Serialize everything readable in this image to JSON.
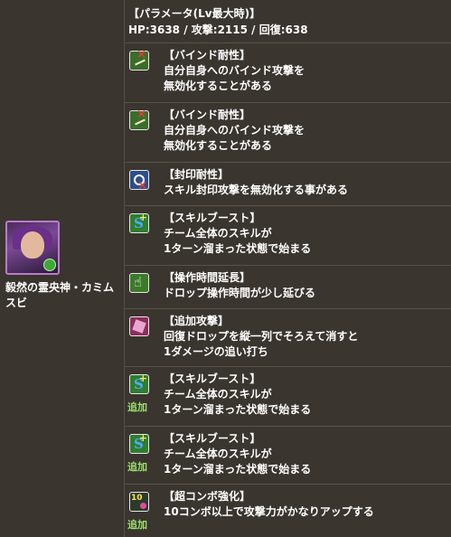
{
  "monster": {
    "name": "毅然の霊央神・カミムスビ"
  },
  "parameters": {
    "title": "【パラメータ(Lv最大時)】",
    "values": "HP:3638 / 攻撃:2115 / 回復:638"
  },
  "awakenings": [
    {
      "icon": "bind-resist-icon",
      "title": "【バインド耐性】",
      "lines": [
        "自分自身へのバインド攻撃を",
        "無効化することがある"
      ],
      "added": ""
    },
    {
      "icon": "bind-resist-icon",
      "title": "【バインド耐性】",
      "lines": [
        "自分自身へのバインド攻撃を",
        "無効化することがある"
      ],
      "added": ""
    },
    {
      "icon": "seal-resist-icon",
      "title": "【封印耐性】",
      "lines": [
        "スキル封印攻撃を無効化する事がある",
        ""
      ],
      "added": ""
    },
    {
      "icon": "skill-boost-icon",
      "title": "【スキルブースト】",
      "lines": [
        "チーム全体のスキルが",
        "1ターン溜まった状態で始まる"
      ],
      "added": ""
    },
    {
      "icon": "time-extend-icon",
      "title": "【操作時間延長】",
      "lines": [
        "ドロップ操作時間が少し延びる",
        ""
      ],
      "added": ""
    },
    {
      "icon": "pursuit-icon",
      "title": "【追加攻撃】",
      "lines": [
        "回復ドロップを縦一列でそろえて消すと",
        "1ダメージの追い打ち"
      ],
      "added": ""
    },
    {
      "icon": "skill-boost-icon",
      "title": "【スキルブースト】",
      "lines": [
        "チーム全体のスキルが",
        "1ターン溜まった状態で始まる"
      ],
      "added": "追加"
    },
    {
      "icon": "skill-boost-icon",
      "title": "【スキルブースト】",
      "lines": [
        "チーム全体のスキルが",
        "1ターン溜まった状態で始まる"
      ],
      "added": "追加"
    },
    {
      "icon": "combo-boost-icon",
      "title": "【超コンボ強化】",
      "lines": [
        "10コンボ以上で攻撃力がかなりアップする",
        ""
      ],
      "added": "追加"
    }
  ]
}
